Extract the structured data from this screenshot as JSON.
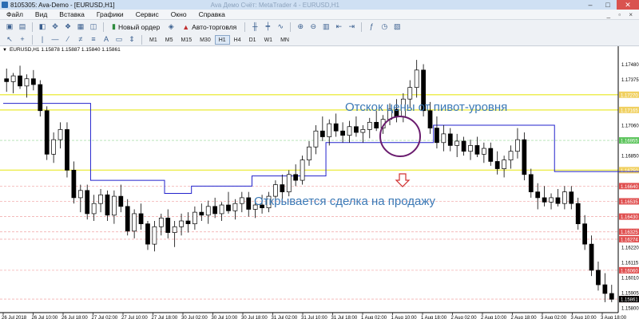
{
  "window": {
    "title": "8105305: Ava-Demo - [EURUSD,H1]",
    "blurred_title": "Ava Демо Счёт: MetaTrader 4 - EURUSD,H1",
    "minimize": "–",
    "maximize": "□",
    "close": "✕"
  },
  "menu": {
    "file": "Файл",
    "view": "Вид",
    "insert": "Вставка",
    "charts": "Графики",
    "service": "Сервис",
    "window": "Окно",
    "help": "Справка",
    "controls": "_ ▫ ×"
  },
  "toolbar": {
    "new_order": "Новый ордер",
    "autotrading": "Авто-торговля",
    "timeframes": [
      "M1",
      "M5",
      "M15",
      "M30",
      "H1",
      "H4",
      "D1",
      "W1",
      "MN"
    ]
  },
  "chart": {
    "symbol_label": "EURUSD,H1",
    "ohlc": "1.15878 1.15887 1.15840 1.15861",
    "annotation_top": "Отскок цены от пивот-уровня",
    "annotation_bottom": "Открывается сделка на продажу",
    "colors": {
      "candle": "#000000",
      "pivot_line": "#2222cc",
      "annotation_text": "#3a78b5",
      "circle": "#6a1c6e",
      "sell_arrow": "#d03030",
      "grid_pink": "#f3b0b0",
      "yellow_level": "#eeee55"
    }
  },
  "chart_data": {
    "type": "candlestick",
    "symbol": "EURUSD",
    "timeframe": "H1",
    "y_ticks": [
      1.1748,
      1.17375,
      1.17165,
      1.1706,
      1.16955,
      1.1685,
      1.1664,
      1.16535,
      1.1643,
      1.1622,
      1.16115,
      1.1601,
      1.15905,
      1.158
    ],
    "highlighted_levels": [
      {
        "value": 1.1727,
        "color": "#f0d060"
      },
      {
        "value": 1.17165,
        "color": "#f0d060"
      },
      {
        "value": 1.16955,
        "color": "#5cc45c"
      },
      {
        "value": 1.1675,
        "color": "#f0d060"
      },
      {
        "value": 1.16325,
        "color": "#e05050"
      },
      {
        "value": 1.1664,
        "color": "#e05050"
      },
      {
        "value": 1.16535,
        "color": "#e05050"
      },
      {
        "value": 1.1643,
        "color": "#e05050"
      },
      {
        "value": 1.16274,
        "color": "#e05050"
      },
      {
        "value": 1.1606,
        "color": "#e05050"
      },
      {
        "value": 1.15861,
        "color": "#e05050"
      }
    ],
    "current_price": 1.15861,
    "x_labels": [
      "26 Jul 2018",
      "26 Jul 10:00",
      "26 Jul 18:00",
      "27 Jul 02:00",
      "27 Jul 10:00",
      "27 Jul 18:00",
      "30 Jul 02:00",
      "30 Jul 10:00",
      "30 Jul 18:00",
      "31 Jul 02:00",
      "31 Jul 10:00",
      "31 Jul 18:00",
      "1 Aug 02:00",
      "1 Aug 10:00",
      "1 Aug 18:00",
      "2 Aug 02:00",
      "2 Aug 10:00",
      "2 Aug 18:00",
      "3 Aug 02:00",
      "3 Aug 10:00",
      "3 Aug 18:00"
    ],
    "ylim": [
      1.1579,
      1.1756
    ],
    "candles": [
      [
        1.1738,
        1.1745,
        1.1729,
        1.1736
      ],
      [
        1.1736,
        1.1742,
        1.1728,
        1.174
      ],
      [
        1.174,
        1.1747,
        1.1731,
        1.1733
      ],
      [
        1.1733,
        1.1741,
        1.1725,
        1.1738
      ],
      [
        1.1738,
        1.1744,
        1.173,
        1.1734
      ],
      [
        1.1734,
        1.1737,
        1.1712,
        1.1716
      ],
      [
        1.1716,
        1.1719,
        1.1682,
        1.1686
      ],
      [
        1.1686,
        1.1701,
        1.168,
        1.1696
      ],
      [
        1.1696,
        1.1708,
        1.169,
        1.1703
      ],
      [
        1.1703,
        1.1708,
        1.167,
        1.1675
      ],
      [
        1.1675,
        1.1681,
        1.1652,
        1.1656
      ],
      [
        1.1656,
        1.1665,
        1.1646,
        1.1661
      ],
      [
        1.1661,
        1.1665,
        1.1641,
        1.1645
      ],
      [
        1.1645,
        1.1658,
        1.164,
        1.1652
      ],
      [
        1.1652,
        1.1662,
        1.1646,
        1.1658
      ],
      [
        1.1658,
        1.1661,
        1.164,
        1.1644
      ],
      [
        1.1644,
        1.1661,
        1.1638,
        1.1657
      ],
      [
        1.1657,
        1.1665,
        1.1646,
        1.165
      ],
      [
        1.165,
        1.1655,
        1.163,
        1.1633
      ],
      [
        1.1633,
        1.1648,
        1.1628,
        1.1645
      ],
      [
        1.1645,
        1.1652,
        1.1634,
        1.1638
      ],
      [
        1.1638,
        1.164,
        1.162,
        1.1624
      ],
      [
        1.1624,
        1.164,
        1.1619,
        1.1636
      ],
      [
        1.1636,
        1.1645,
        1.163,
        1.1642
      ],
      [
        1.1642,
        1.1648,
        1.1628,
        1.1632
      ],
      [
        1.1632,
        1.164,
        1.1622,
        1.1636
      ],
      [
        1.1636,
        1.1645,
        1.163,
        1.164
      ],
      [
        1.164,
        1.1646,
        1.1632,
        1.1638
      ],
      [
        1.1638,
        1.165,
        1.1634,
        1.1646
      ],
      [
        1.1646,
        1.1652,
        1.164,
        1.1644
      ],
      [
        1.1644,
        1.1654,
        1.1638,
        1.165
      ],
      [
        1.165,
        1.1656,
        1.1642,
        1.1645
      ],
      [
        1.1645,
        1.1653,
        1.164,
        1.1651
      ],
      [
        1.1651,
        1.166,
        1.1645,
        1.1647
      ],
      [
        1.1647,
        1.1655,
        1.1641,
        1.1652
      ],
      [
        1.1652,
        1.166,
        1.1646,
        1.1656
      ],
      [
        1.1656,
        1.166,
        1.1643,
        1.1648
      ],
      [
        1.1648,
        1.1655,
        1.1642,
        1.1651
      ],
      [
        1.1651,
        1.1658,
        1.1645,
        1.1649
      ],
      [
        1.1649,
        1.166,
        1.1646,
        1.1657
      ],
      [
        1.1657,
        1.1668,
        1.165,
        1.1665
      ],
      [
        1.1665,
        1.1672,
        1.1655,
        1.166
      ],
      [
        1.166,
        1.1675,
        1.1657,
        1.1672
      ],
      [
        1.1672,
        1.1679,
        1.1664,
        1.1668
      ],
      [
        1.1668,
        1.1685,
        1.1665,
        1.1682
      ],
      [
        1.1682,
        1.1695,
        1.1678,
        1.1691
      ],
      [
        1.1691,
        1.1706,
        1.1686,
        1.1702
      ],
      [
        1.1702,
        1.1712,
        1.1695,
        1.1698
      ],
      [
        1.1698,
        1.171,
        1.1692,
        1.1707
      ],
      [
        1.1707,
        1.1714,
        1.1698,
        1.1702
      ],
      [
        1.1702,
        1.1708,
        1.1694,
        1.1699
      ],
      [
        1.1699,
        1.1709,
        1.1694,
        1.1705
      ],
      [
        1.1705,
        1.1712,
        1.1698,
        1.1701
      ],
      [
        1.1701,
        1.1706,
        1.1694,
        1.1703
      ],
      [
        1.1703,
        1.1711,
        1.1697,
        1.1708
      ],
      [
        1.1708,
        1.1716,
        1.1702,
        1.1704
      ],
      [
        1.1704,
        1.1713,
        1.17,
        1.171
      ],
      [
        1.171,
        1.1721,
        1.1706,
        1.1717
      ],
      [
        1.1717,
        1.1724,
        1.1708,
        1.1712
      ],
      [
        1.1712,
        1.1728,
        1.1708,
        1.1724
      ],
      [
        1.1724,
        1.1737,
        1.1718,
        1.1732
      ],
      [
        1.1732,
        1.1751,
        1.1725,
        1.1744
      ],
      [
        1.1744,
        1.1748,
        1.1712,
        1.1716
      ],
      [
        1.1716,
        1.1722,
        1.17,
        1.1704
      ],
      [
        1.1704,
        1.1712,
        1.169,
        1.1694
      ],
      [
        1.1694,
        1.1706,
        1.1688,
        1.17
      ],
      [
        1.17,
        1.1704,
        1.1688,
        1.1692
      ],
      [
        1.1692,
        1.17,
        1.1684,
        1.1695
      ],
      [
        1.1695,
        1.1698,
        1.1685,
        1.1688
      ],
      [
        1.1688,
        1.1696,
        1.1682,
        1.1692
      ],
      [
        1.1692,
        1.1698,
        1.1684,
        1.1686
      ],
      [
        1.1686,
        1.1694,
        1.168,
        1.169
      ],
      [
        1.169,
        1.1694,
        1.1678,
        1.1681
      ],
      [
        1.1681,
        1.1688,
        1.1672,
        1.1676
      ],
      [
        1.1676,
        1.1685,
        1.167,
        1.1682
      ],
      [
        1.1682,
        1.1692,
        1.1676,
        1.1688
      ],
      [
        1.1688,
        1.1704,
        1.1683,
        1.1696
      ],
      [
        1.1696,
        1.1701,
        1.1668,
        1.1672
      ],
      [
        1.1672,
        1.1676,
        1.1656,
        1.166
      ],
      [
        1.166,
        1.1666,
        1.1648,
        1.1656
      ],
      [
        1.1656,
        1.1664,
        1.165,
        1.1653
      ],
      [
        1.1653,
        1.1659,
        1.1648,
        1.1656
      ],
      [
        1.1656,
        1.1662,
        1.165,
        1.1652
      ],
      [
        1.1652,
        1.1664,
        1.1648,
        1.166
      ],
      [
        1.166,
        1.1664,
        1.1648,
        1.1652
      ],
      [
        1.1652,
        1.1656,
        1.1634,
        1.1638
      ],
      [
        1.1638,
        1.1644,
        1.162,
        1.1624
      ],
      [
        1.1624,
        1.163,
        1.1602,
        1.1606
      ],
      [
        1.1606,
        1.1612,
        1.1592,
        1.1596
      ],
      [
        1.1596,
        1.1604,
        1.1584,
        1.159
      ],
      [
        1.159,
        1.1596,
        1.1584,
        1.1586
      ]
    ],
    "pivot_line": [
      [
        0,
        1.1721
      ],
      [
        13,
        1.1721
      ],
      [
        13,
        1.1668
      ],
      [
        24,
        1.1668
      ],
      [
        24,
        1.1659
      ],
      [
        28,
        1.1659
      ],
      [
        28,
        1.1664
      ],
      [
        37,
        1.1664
      ],
      [
        37,
        1.1671
      ],
      [
        48,
        1.1671
      ],
      [
        48,
        1.1694
      ],
      [
        64,
        1.1694
      ],
      [
        64,
        1.1706
      ],
      [
        82,
        1.1706
      ],
      [
        82,
        1.1674
      ],
      [
        95,
        1.1674
      ]
    ]
  }
}
